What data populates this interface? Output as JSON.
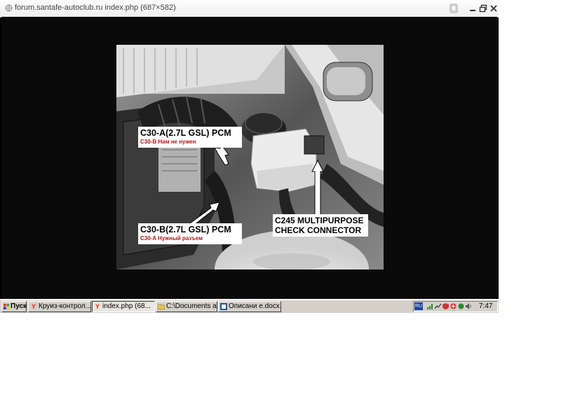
{
  "window": {
    "title": "forum.santafe-autoclub.ru index.php (687×582)"
  },
  "photo": {
    "callouts": {
      "c30a_title": "C30-A(2.7L GSL) PCM",
      "c30a_note": "C30-B Нам не нужен",
      "c30b_title": "C30-B(2.7L GSL) PCM",
      "c30b_note": "C30-A Нужный разъем",
      "c245_line1": "C245 MULTIPURPOSE",
      "c245_line2": "CHECK CONNECTOR"
    },
    "note_color": "#b01818"
  },
  "taskbar": {
    "start_label": "Пуск",
    "tasks": [
      {
        "label": "Круиз-контрол...",
        "icon": "yandex-icon"
      },
      {
        "label": "index.php (68...",
        "icon": "yandex-icon"
      },
      {
        "label": "C:\\Documents a...",
        "icon": "folder-icon"
      },
      {
        "label": "Описани e.docx...",
        "icon": "word-icon"
      }
    ],
    "language": "RU",
    "clock": "7:47"
  }
}
